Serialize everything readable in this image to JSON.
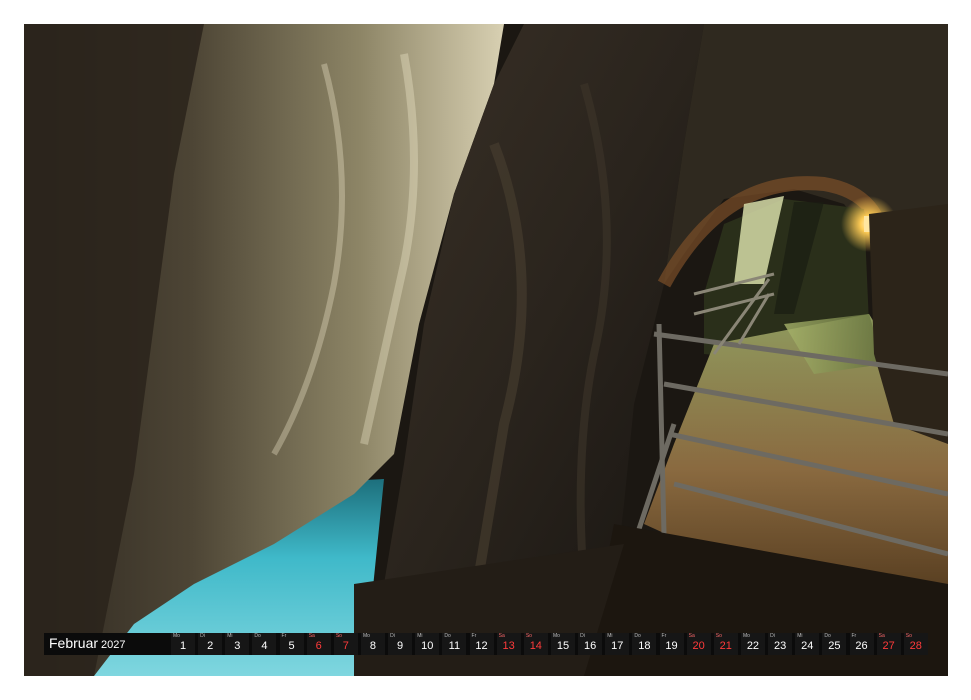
{
  "calendar": {
    "month": "Februar",
    "year": "2027",
    "days": [
      {
        "wd": "Mo",
        "d": "1",
        "red": false
      },
      {
        "wd": "Di",
        "d": "2",
        "red": false
      },
      {
        "wd": "Mi",
        "d": "3",
        "red": false
      },
      {
        "wd": "Do",
        "d": "4",
        "red": false
      },
      {
        "wd": "Fr",
        "d": "5",
        "red": false
      },
      {
        "wd": "Sa",
        "d": "6",
        "red": true
      },
      {
        "wd": "So",
        "d": "7",
        "red": true
      },
      {
        "wd": "Mo",
        "d": "8",
        "red": false
      },
      {
        "wd": "Di",
        "d": "9",
        "red": false
      },
      {
        "wd": "Mi",
        "d": "10",
        "red": false
      },
      {
        "wd": "Do",
        "d": "11",
        "red": false
      },
      {
        "wd": "Fr",
        "d": "12",
        "red": false
      },
      {
        "wd": "Sa",
        "d": "13",
        "red": true
      },
      {
        "wd": "So",
        "d": "14",
        "red": true
      },
      {
        "wd": "Mo",
        "d": "15",
        "red": false
      },
      {
        "wd": "Di",
        "d": "16",
        "red": false
      },
      {
        "wd": "Mi",
        "d": "17",
        "red": false
      },
      {
        "wd": "Do",
        "d": "18",
        "red": false
      },
      {
        "wd": "Fr",
        "d": "19",
        "red": false
      },
      {
        "wd": "Sa",
        "d": "20",
        "red": true
      },
      {
        "wd": "So",
        "d": "21",
        "red": true
      },
      {
        "wd": "Mo",
        "d": "22",
        "red": false
      },
      {
        "wd": "Di",
        "d": "23",
        "red": false
      },
      {
        "wd": "Mi",
        "d": "24",
        "red": false
      },
      {
        "wd": "Do",
        "d": "25",
        "red": false
      },
      {
        "wd": "Fr",
        "d": "26",
        "red": false
      },
      {
        "wd": "Sa",
        "d": "27",
        "red": true
      },
      {
        "wd": "So",
        "d": "28",
        "red": true
      }
    ]
  },
  "colors": {
    "weekend": "#ff3b3b",
    "water": "#3fb9c9",
    "rock_dark": "#2a241e",
    "rock_light": "#cfc7a8"
  }
}
